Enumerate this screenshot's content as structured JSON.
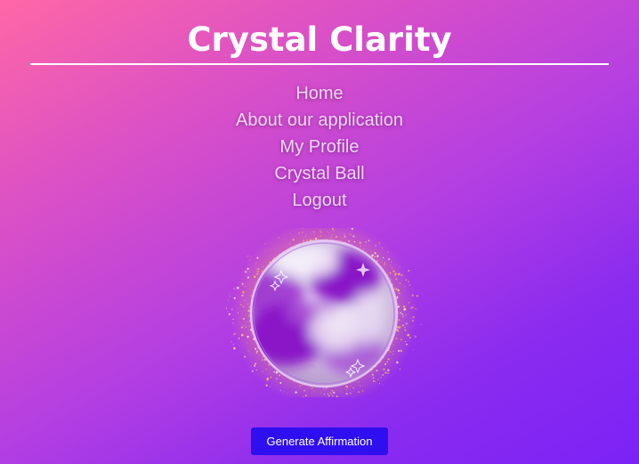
{
  "header": {
    "title": "Crystal Clarity"
  },
  "nav": {
    "items": [
      {
        "label": "Home"
      },
      {
        "label": "About our application"
      },
      {
        "label": "My Profile"
      },
      {
        "label": "Crystal Ball"
      },
      {
        "label": "Logout"
      }
    ]
  },
  "crystal_ball": {
    "icon": "crystal-ball-icon",
    "sparkle_icon": "sparkle-icon"
  },
  "actions": {
    "generate_label": "Generate Affirmation"
  },
  "colors": {
    "background_start": "#ff67a6",
    "background_end": "#7c22f6",
    "button": "#2f0ff0",
    "ball_purple": "#8a12c8"
  }
}
